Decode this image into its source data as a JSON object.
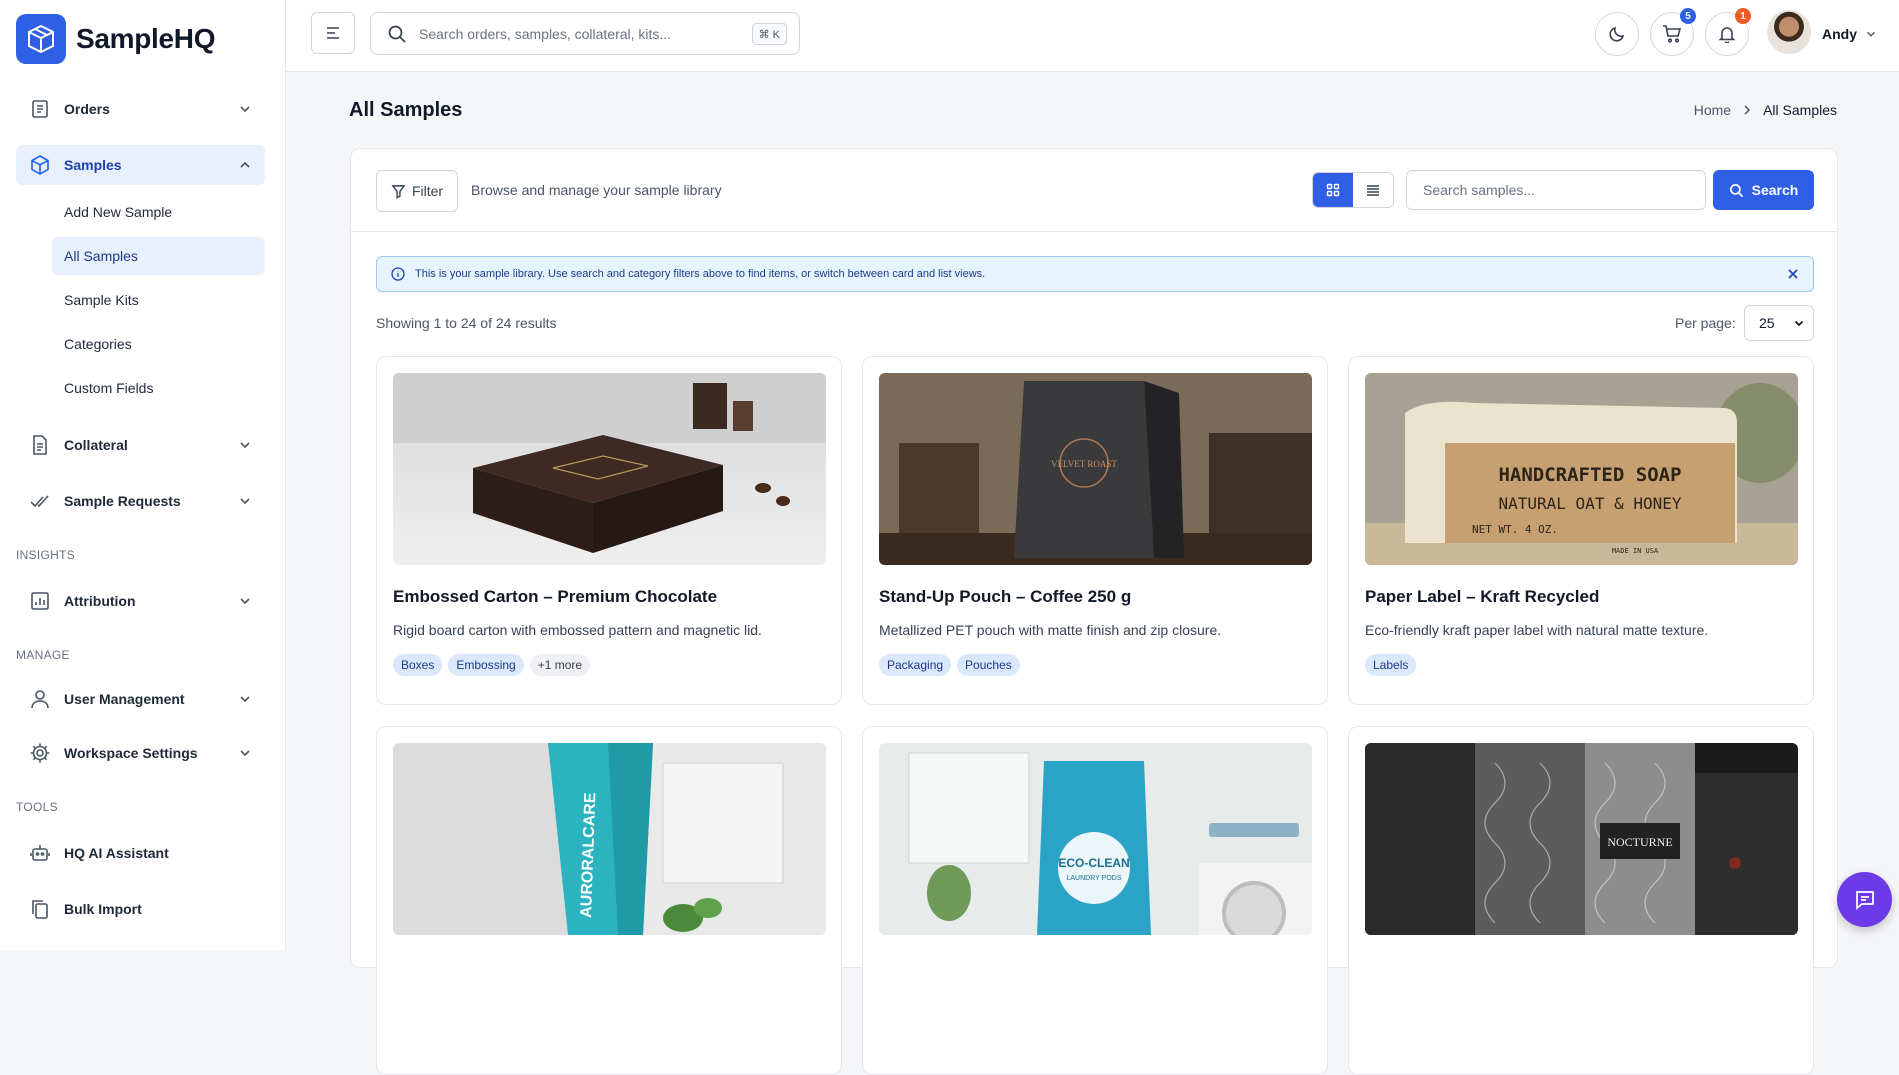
{
  "app": {
    "name": "SampleHQ"
  },
  "sidebar": {
    "orders": "Orders",
    "samples": "Samples",
    "samples_sub": [
      "Add New Sample",
      "All Samples",
      "Sample Kits",
      "Categories",
      "Custom Fields"
    ],
    "collateral": "Collateral",
    "sample_requests": "Sample Requests",
    "insights_label": "INSIGHTS",
    "attribution": "Attribution",
    "manage_label": "MANAGE",
    "user_management": "User Management",
    "workspace_settings": "Workspace Settings",
    "tools_label": "TOOLS",
    "ai_assistant": "HQ AI Assistant",
    "bulk_import": "Bulk Import"
  },
  "topbar": {
    "search_placeholder": "Search orders, samples, collateral, kits...",
    "shortcut": "⌘ K",
    "cart_count": "5",
    "notif_count": "1",
    "user_name": "Andy"
  },
  "page": {
    "title": "All Samples",
    "breadcrumb": [
      "Home",
      "All Samples"
    ]
  },
  "toolbar": {
    "filter_label": "Filter",
    "description": "Browse and manage your sample library",
    "search_placeholder": "Search samples...",
    "search_button": "Search"
  },
  "info": {
    "message": "This is your sample library. Use search and category filters above to find items, or switch between card and list views."
  },
  "results": {
    "summary": "Showing 1 to 24 of 24 results",
    "per_page_label": "Per page:",
    "per_page_value": "25"
  },
  "cards": [
    {
      "title": "Embossed Carton – Premium Chocolate",
      "description": "Rigid board carton with embossed pattern and magnetic lid.",
      "tags": [
        "Boxes",
        "Embossing"
      ],
      "more": "+1 more",
      "image": "chocolate-box-image"
    },
    {
      "title": "Stand-Up Pouch – Coffee 250 g",
      "description": "Metallized PET pouch with matte finish and zip closure.",
      "tags": [
        "Packaging",
        "Pouches"
      ],
      "more": "",
      "image": "coffee-pouch-image"
    },
    {
      "title": "Paper Label – Kraft Recycled",
      "description": "Eco-friendly kraft paper label with natural matte texture.",
      "tags": [
        "Labels"
      ],
      "more": "",
      "image": "soap-label-image"
    },
    {
      "title": "",
      "description": "",
      "tags": [],
      "more": "",
      "image": "toothpaste-tube-image"
    },
    {
      "title": "",
      "description": "",
      "tags": [],
      "more": "",
      "image": "laundry-pouch-image"
    },
    {
      "title": "",
      "description": "",
      "tags": [],
      "more": "",
      "image": "perfume-box-image"
    }
  ],
  "image_text": {
    "soap_line1": "HANDCRAFTED SOAP",
    "soap_line2": "NATURAL OAT & HONEY",
    "soap_line3": "NET WT. 4 OZ.",
    "soap_line4": "MADE IN USA",
    "coffee": "VELVET ROAST",
    "tube": "AURORALCARE",
    "laundry_line1": "ECO-CLEAN",
    "laundry_line2": "LAUNDRY PODS",
    "perfume": "NOCTURNE"
  },
  "colors": {
    "accent": "#2f5fe4",
    "active_bg": "#e8effd",
    "chat": "#6d3ae8",
    "badge_cart": "#2f5fe4",
    "badge_notif": "#f05a28"
  }
}
